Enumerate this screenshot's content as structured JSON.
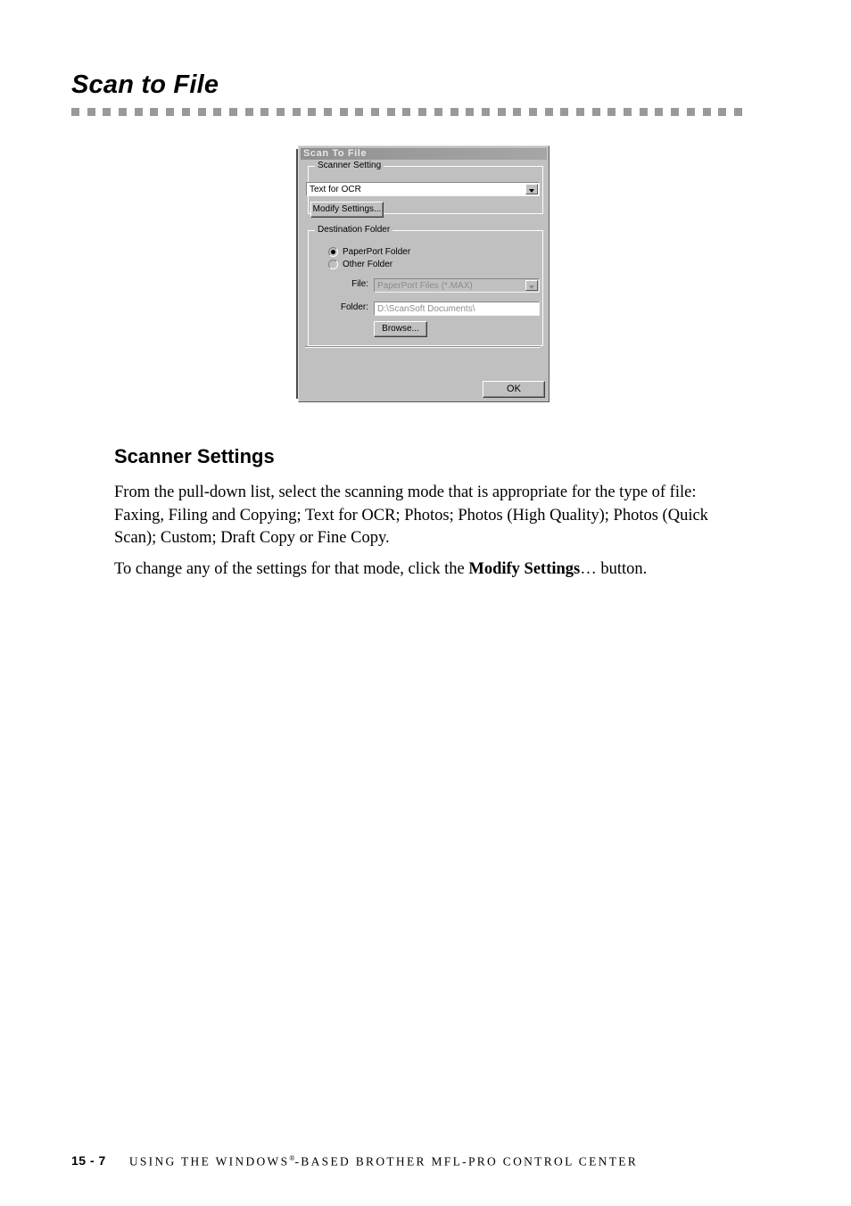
{
  "page": {
    "heading": "Scan to File",
    "section_heading": "Scanner Settings",
    "paragraph_1": "From the pull-down list, select the scanning mode that is appropriate for the type of file:  Faxing, Filing and Copying; Text for OCR; Photos; Photos (High Quality); Photos (Quick Scan); Custom; Draft Copy or Fine Copy.",
    "paragraph_2_before": "To change any of the settings for that mode, click the ",
    "paragraph_2_bold": "Modify Settings",
    "paragraph_2_after": "… button."
  },
  "dialog": {
    "title": "Scan To File",
    "scanner_setting": {
      "legend": "Scanner Setting",
      "mode_selected": "Text for OCR",
      "mode_options": [
        "Faxing, Filing and Copying",
        "Text for OCR",
        "Photos",
        "Photos (High Quality)",
        "Photos (Quick Scan)",
        "Custom",
        "Draft Copy",
        "Fine Copy"
      ],
      "modify_button": "Modify Settings..."
    },
    "destination_folder": {
      "legend": "Destination Folder",
      "radio_paperport": "PaperPort Folder",
      "radio_other": "Other Folder",
      "selected_radio": "PaperPort Folder",
      "file_label": "File:",
      "file_value": "PaperPort Files (*.MAX)",
      "folder_label": "Folder:",
      "folder_value": "D:\\ScanSoft Documents\\",
      "browse_button": "Browse..."
    },
    "ok_button": "OK"
  },
  "footer": {
    "page_number": "15 - 7",
    "title_before": "USING THE WINDOWS",
    "title_registered": "®",
    "title_after": "-BASED BROTHER MFL-PRO CONTROL CENTER"
  },
  "colors": {
    "dialog_face": "#c0c0c0",
    "titlebar": "#9a9a9a",
    "rule_square": "#999999",
    "text": "#000000",
    "disabled_text": "#8c8c8c"
  }
}
